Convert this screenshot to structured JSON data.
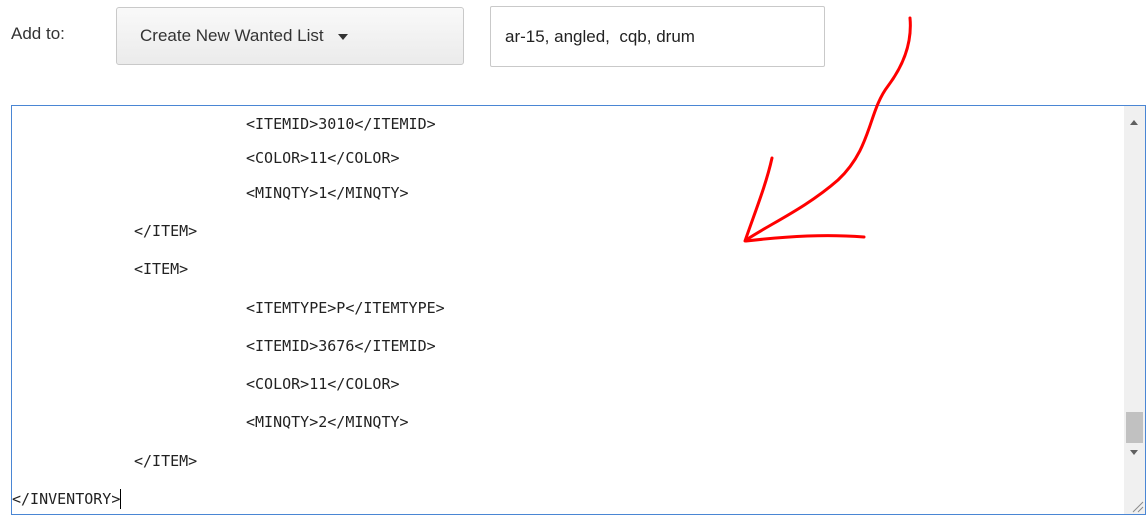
{
  "form": {
    "add_to_label": "Add to:",
    "wanted_list_select": "Create New Wanted List",
    "tags_value": "ar-15, angled,  cqb, drum"
  },
  "editor": {
    "lines": [
      "\t\t<ITEMID>3010</ITEMID>",
      "\t\t<COLOR>11</COLOR>",
      "\t\t<MINQTY>1</MINQTY>",
      "\t</ITEM>",
      "\t<ITEM>",
      "\t\t<ITEMTYPE>P</ITEMTYPE>",
      "\t\t<ITEMID>3676</ITEMID>",
      "\t\t<COLOR>11</COLOR>",
      "\t\t<MINQTY>2</MINQTY>",
      "\t</ITEM>",
      "</INVENTORY>"
    ]
  },
  "icons": {
    "select_caret": "chevron-down-icon",
    "scroll_up": "arrow-up-icon",
    "scroll_down": "arrow-down-icon",
    "resize": "resize-grip-icon"
  },
  "colors": {
    "editor_border": "#4a86d4",
    "annotation": "#ff0000",
    "scroll_thumb": "#c1c1c1"
  }
}
